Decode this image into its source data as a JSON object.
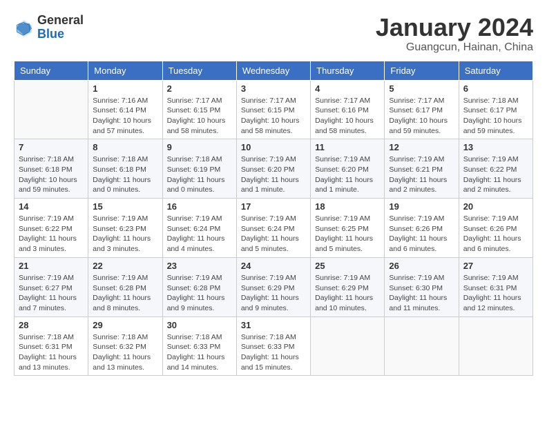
{
  "header": {
    "logo_general": "General",
    "logo_blue": "Blue",
    "month_title": "January 2024",
    "subtitle": "Guangcun, Hainan, China"
  },
  "weekdays": [
    "Sunday",
    "Monday",
    "Tuesday",
    "Wednesday",
    "Thursday",
    "Friday",
    "Saturday"
  ],
  "weeks": [
    [
      {
        "day": null,
        "info": null
      },
      {
        "day": "1",
        "info": "Sunrise: 7:16 AM\nSunset: 6:14 PM\nDaylight: 10 hours\nand 57 minutes."
      },
      {
        "day": "2",
        "info": "Sunrise: 7:17 AM\nSunset: 6:15 PM\nDaylight: 10 hours\nand 58 minutes."
      },
      {
        "day": "3",
        "info": "Sunrise: 7:17 AM\nSunset: 6:15 PM\nDaylight: 10 hours\nand 58 minutes."
      },
      {
        "day": "4",
        "info": "Sunrise: 7:17 AM\nSunset: 6:16 PM\nDaylight: 10 hours\nand 58 minutes."
      },
      {
        "day": "5",
        "info": "Sunrise: 7:17 AM\nSunset: 6:17 PM\nDaylight: 10 hours\nand 59 minutes."
      },
      {
        "day": "6",
        "info": "Sunrise: 7:18 AM\nSunset: 6:17 PM\nDaylight: 10 hours\nand 59 minutes."
      }
    ],
    [
      {
        "day": "7",
        "info": "Sunrise: 7:18 AM\nSunset: 6:18 PM\nDaylight: 10 hours\nand 59 minutes."
      },
      {
        "day": "8",
        "info": "Sunrise: 7:18 AM\nSunset: 6:18 PM\nDaylight: 11 hours\nand 0 minutes."
      },
      {
        "day": "9",
        "info": "Sunrise: 7:18 AM\nSunset: 6:19 PM\nDaylight: 11 hours\nand 0 minutes."
      },
      {
        "day": "10",
        "info": "Sunrise: 7:19 AM\nSunset: 6:20 PM\nDaylight: 11 hours\nand 1 minute."
      },
      {
        "day": "11",
        "info": "Sunrise: 7:19 AM\nSunset: 6:20 PM\nDaylight: 11 hours\nand 1 minute."
      },
      {
        "day": "12",
        "info": "Sunrise: 7:19 AM\nSunset: 6:21 PM\nDaylight: 11 hours\nand 2 minutes."
      },
      {
        "day": "13",
        "info": "Sunrise: 7:19 AM\nSunset: 6:22 PM\nDaylight: 11 hours\nand 2 minutes."
      }
    ],
    [
      {
        "day": "14",
        "info": "Sunrise: 7:19 AM\nSunset: 6:22 PM\nDaylight: 11 hours\nand 3 minutes."
      },
      {
        "day": "15",
        "info": "Sunrise: 7:19 AM\nSunset: 6:23 PM\nDaylight: 11 hours\nand 3 minutes."
      },
      {
        "day": "16",
        "info": "Sunrise: 7:19 AM\nSunset: 6:24 PM\nDaylight: 11 hours\nand 4 minutes."
      },
      {
        "day": "17",
        "info": "Sunrise: 7:19 AM\nSunset: 6:24 PM\nDaylight: 11 hours\nand 5 minutes."
      },
      {
        "day": "18",
        "info": "Sunrise: 7:19 AM\nSunset: 6:25 PM\nDaylight: 11 hours\nand 5 minutes."
      },
      {
        "day": "19",
        "info": "Sunrise: 7:19 AM\nSunset: 6:26 PM\nDaylight: 11 hours\nand 6 minutes."
      },
      {
        "day": "20",
        "info": "Sunrise: 7:19 AM\nSunset: 6:26 PM\nDaylight: 11 hours\nand 6 minutes."
      }
    ],
    [
      {
        "day": "21",
        "info": "Sunrise: 7:19 AM\nSunset: 6:27 PM\nDaylight: 11 hours\nand 7 minutes."
      },
      {
        "day": "22",
        "info": "Sunrise: 7:19 AM\nSunset: 6:28 PM\nDaylight: 11 hours\nand 8 minutes."
      },
      {
        "day": "23",
        "info": "Sunrise: 7:19 AM\nSunset: 6:28 PM\nDaylight: 11 hours\nand 9 minutes."
      },
      {
        "day": "24",
        "info": "Sunrise: 7:19 AM\nSunset: 6:29 PM\nDaylight: 11 hours\nand 9 minutes."
      },
      {
        "day": "25",
        "info": "Sunrise: 7:19 AM\nSunset: 6:29 PM\nDaylight: 11 hours\nand 10 minutes."
      },
      {
        "day": "26",
        "info": "Sunrise: 7:19 AM\nSunset: 6:30 PM\nDaylight: 11 hours\nand 11 minutes."
      },
      {
        "day": "27",
        "info": "Sunrise: 7:19 AM\nSunset: 6:31 PM\nDaylight: 11 hours\nand 12 minutes."
      }
    ],
    [
      {
        "day": "28",
        "info": "Sunrise: 7:18 AM\nSunset: 6:31 PM\nDaylight: 11 hours\nand 13 minutes."
      },
      {
        "day": "29",
        "info": "Sunrise: 7:18 AM\nSunset: 6:32 PM\nDaylight: 11 hours\nand 13 minutes."
      },
      {
        "day": "30",
        "info": "Sunrise: 7:18 AM\nSunset: 6:33 PM\nDaylight: 11 hours\nand 14 minutes."
      },
      {
        "day": "31",
        "info": "Sunrise: 7:18 AM\nSunset: 6:33 PM\nDaylight: 11 hours\nand 15 minutes."
      },
      {
        "day": null,
        "info": null
      },
      {
        "day": null,
        "info": null
      },
      {
        "day": null,
        "info": null
      }
    ]
  ]
}
